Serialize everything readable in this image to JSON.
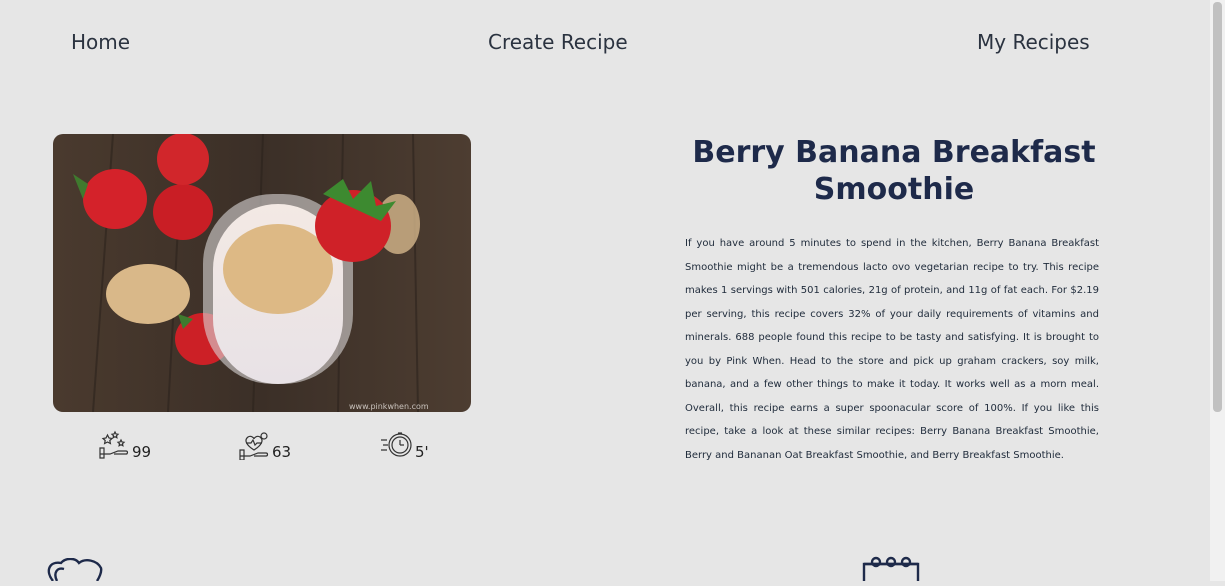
{
  "nav": {
    "home": "Home",
    "create": "Create Recipe",
    "my_recipes": "My Recipes"
  },
  "recipe": {
    "title": "Berry Banana Breakfast Smoothie",
    "image_watermark": "www.pinkwhen.com",
    "summary": "If you have around 5 minutes to spend in the kitchen, Berry Banana Breakfast Smoothie might be a tremendous lacto ovo vegetarian recipe to try. This recipe makes 1 servings with 501 calories, 21g of protein, and 11g of fat each. For $2.19 per serving, this recipe covers 32% of your daily requirements of vitamins and minerals. 688 people found this recipe to be tasty and satisfying. It is brought to you by Pink When. Head to the store and pick up graham crackers, soy milk, banana, and a few other things to make it today. It works well as a morn meal. Overall, this recipe earns a super spoonacular score of 100%. If you like this recipe, take a look at these similar recipes: Berry Banana Breakfast Smoothie, Berry and Bananan Oat Breakfast Smoothie, and Berry Breakfast Smoothie.",
    "stats": {
      "likes": "99",
      "health_score": "63",
      "ready_minutes": "5'"
    }
  },
  "icons": {
    "likes": "stars-hand-icon",
    "health": "heart-hand-icon",
    "time": "stopwatch-icon",
    "bottom_left": "heart-icon",
    "bottom_right": "calendar-icon"
  },
  "colors": {
    "background": "#e6e6e6",
    "title": "#1e2a4a",
    "text": "#1e2a3a"
  }
}
